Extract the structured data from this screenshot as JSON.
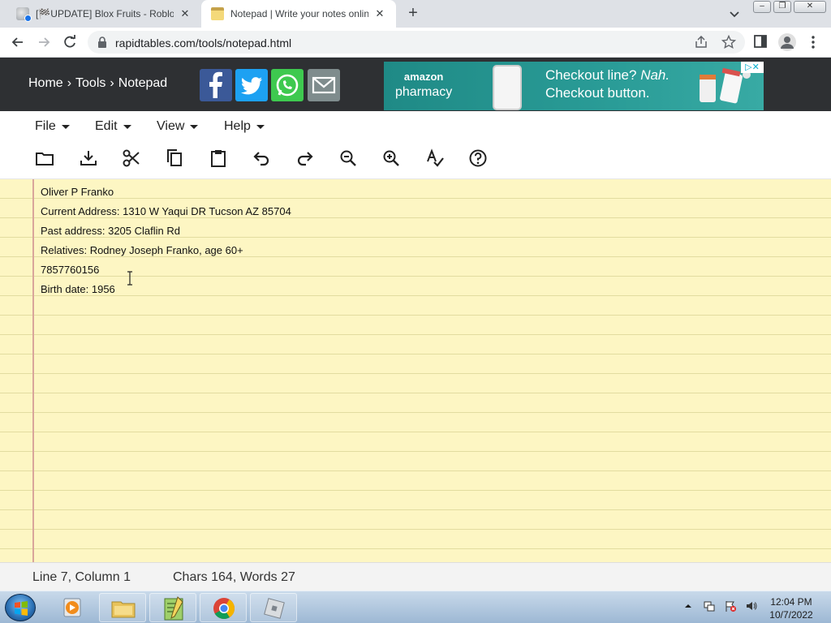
{
  "browser": {
    "tabs": [
      {
        "title": "[🏁UPDATE] Blox Fruits - Roblox",
        "active": false
      },
      {
        "title": "Notepad | Write your notes online",
        "active": true
      }
    ],
    "url": "rapidtables.com/tools/notepad.html"
  },
  "site": {
    "breadcrumb": [
      "Home",
      "›",
      "Tools",
      "›",
      "Notepad"
    ],
    "share_buttons": [
      "facebook",
      "twitter",
      "whatsapp",
      "email"
    ],
    "ad": {
      "brand_line1": "amazon",
      "brand_line2": "pharmacy",
      "headline_line1_a": "Checkout line? ",
      "headline_line1_b": "Nah.",
      "headline_line2": "Checkout button."
    }
  },
  "menus": [
    "File",
    "Edit",
    "View",
    "Help"
  ],
  "tools": [
    "open-folder",
    "save-download",
    "cut",
    "copy",
    "paste",
    "undo",
    "redo",
    "zoom-out",
    "zoom-in",
    "spellcheck",
    "help"
  ],
  "note": {
    "lines": [
      "Oliver P Franko",
      "Current Address: 1310 W Yaqui DR Tucson AZ 85704",
      "Past address: 3205 Claflin Rd",
      "Relatives: Rodney Joseph Franko, age 60+",
      "7857760156",
      "Birth date: 1956"
    ]
  },
  "status": {
    "position": "Line 7, Column 1",
    "counts": "Chars 164, Words 27"
  },
  "taskbar": {
    "time": "12:04 PM",
    "date": "10/7/2022"
  },
  "colors": {
    "header_bg": "#2e3033",
    "paper": "#fdf6c3",
    "rule": "#e2dca0",
    "margin": "#d9a59b"
  }
}
